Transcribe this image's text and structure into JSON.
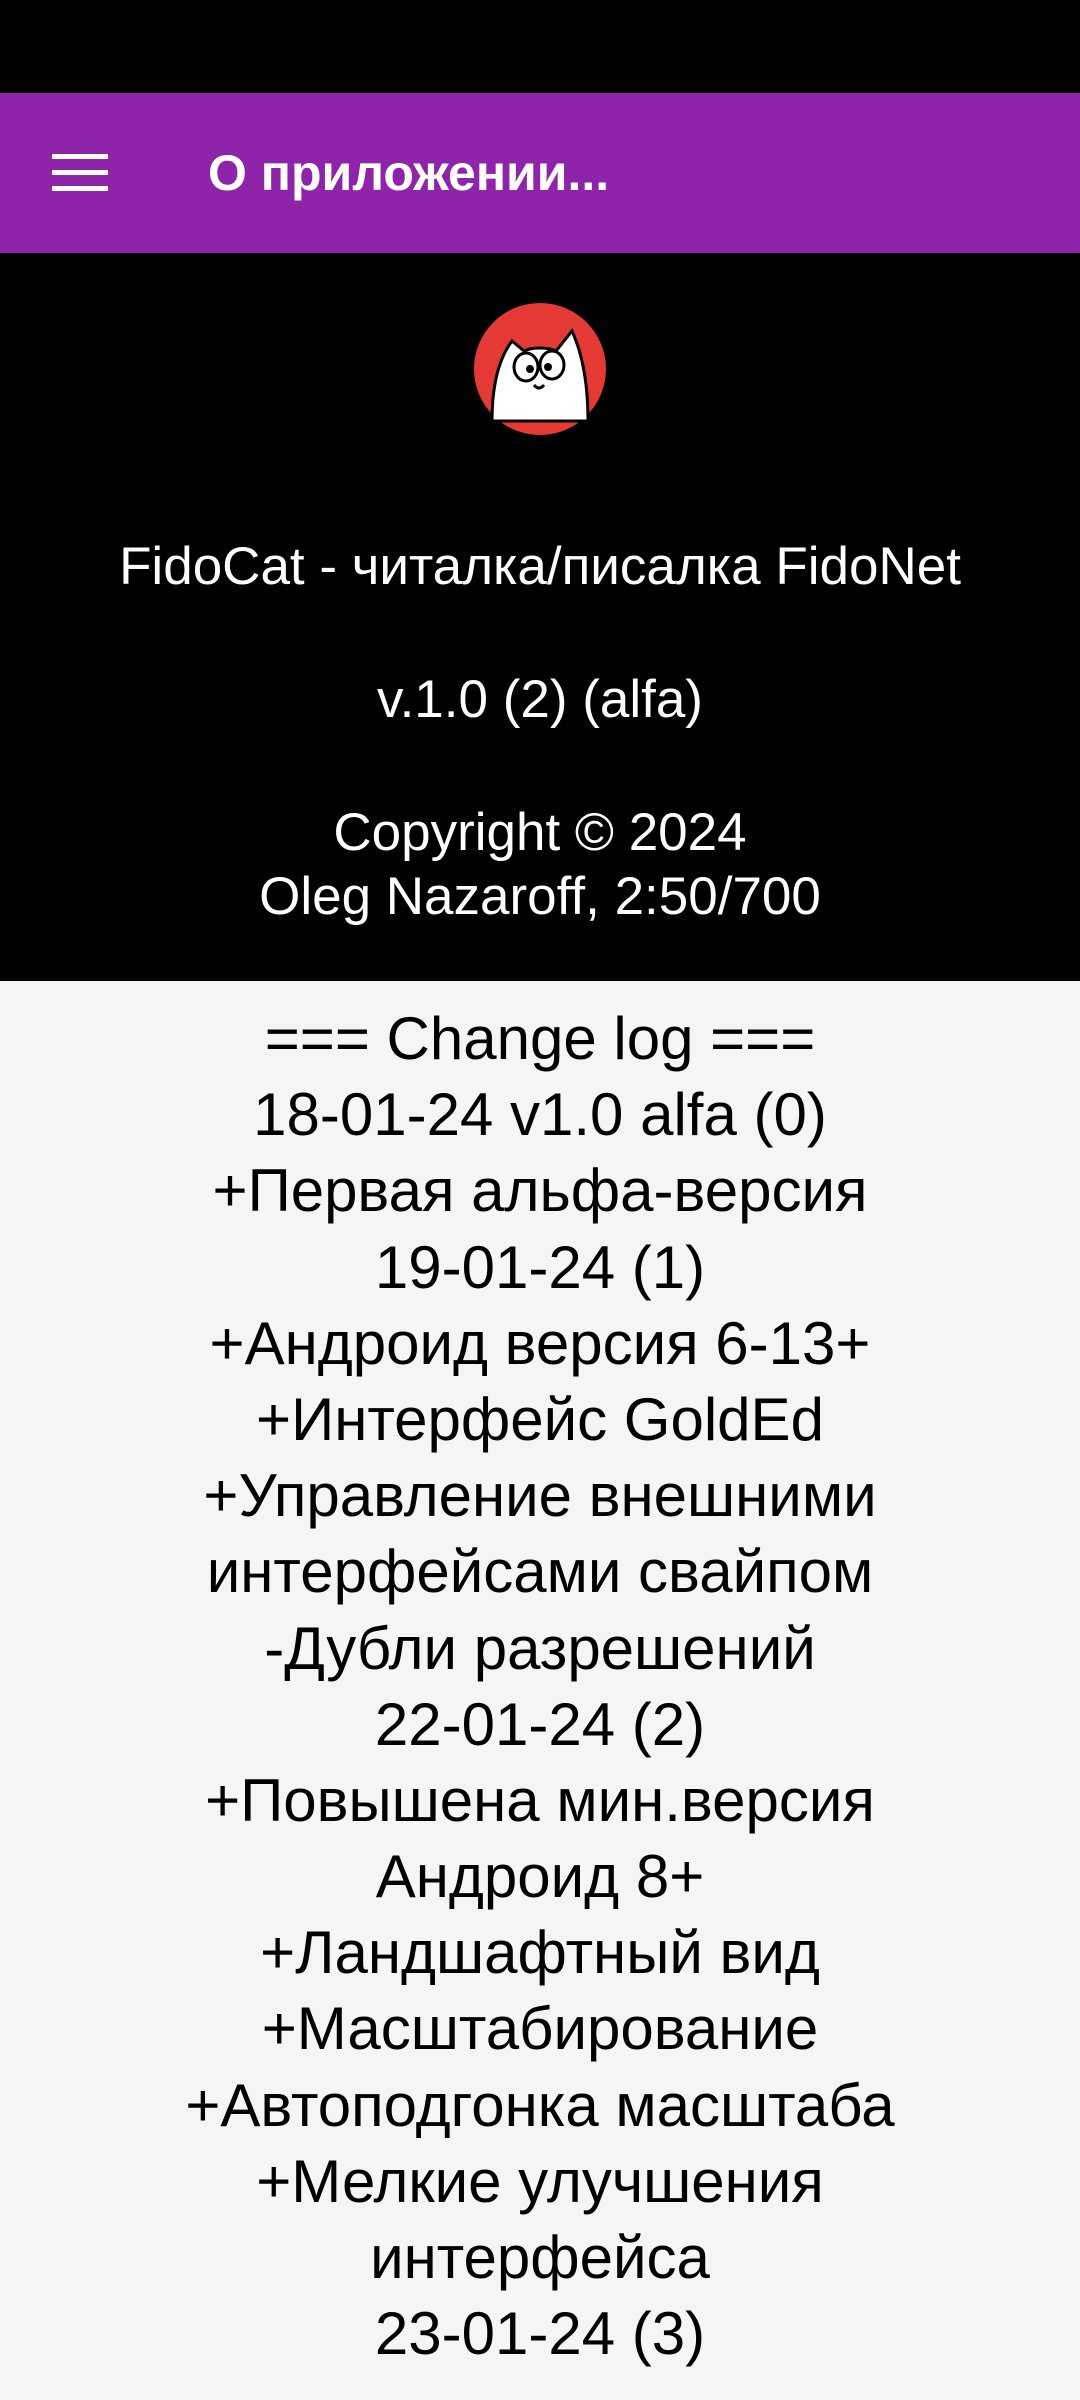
{
  "app_bar": {
    "title": "О приложении...",
    "background_color": "#8e24aa",
    "menu_icon": "hamburger-menu-icon"
  },
  "header": {
    "logo": "cat-face-logo",
    "app_name": "FidoCat - читалка/писалка FidoNet",
    "version": "v.1.0 (2) (alfa)",
    "copyright_line1": "Copyright © 2024",
    "copyright_line2": "Oleg Nazaroff, 2:50/700"
  },
  "changelog": {
    "lines": [
      "=== Change log ===",
      "18-01-24 v1.0 alfa (0)",
      "+Первая альфа-версия",
      "19-01-24 (1)",
      "+Андроид версия 6-13+",
      "+Интерфейс GoldEd",
      "+Управление внешними",
      "интерфейсами свайпом",
      "-Дубли разрешений",
      "22-01-24 (2)",
      "+Повышена мин.версия",
      "Андроид 8+",
      "+Ландшафтный вид",
      "+Масштабирование",
      "+Автоподгонка масштаба",
      "+Мелкие улучшения",
      "интерфейса",
      "23-01-24 (3)"
    ]
  }
}
